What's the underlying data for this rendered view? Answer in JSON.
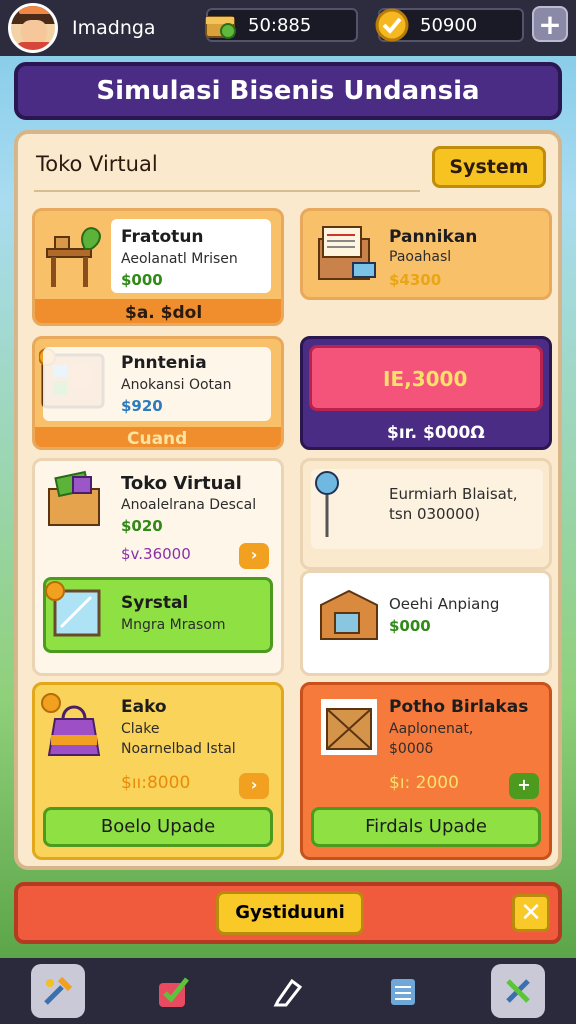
{
  "top": {
    "player_name": "Imadnga",
    "currency1": "50:885",
    "currency2": "50900"
  },
  "header": {
    "title": "Simulasi Bisenis Undansia"
  },
  "panel": {
    "title": "Toko Virtual",
    "system_button": "System"
  },
  "cards": [
    {
      "title": "Fratotun",
      "subtitle": "Aeolanatl Mrisen",
      "price": "$000",
      "footer": "$a. $dol"
    },
    {
      "title": "Pannikan",
      "subtitle": "Paoahasl",
      "price": "$4300"
    },
    {
      "title": "Pnntenia",
      "subtitle": "Anokansi Ootan",
      "price": "$920",
      "footer": "Cuand"
    },
    {
      "big_value": "IE,3000",
      "footer": "$ır. $000Ω"
    },
    {
      "title": "Toko Virtual",
      "subtitle": "Anoalelrana Descal",
      "price": "$020",
      "value": "$v.36000"
    },
    {
      "line1": "Eurmiarh Blaisat,",
      "line2": "tsn 030000)"
    },
    {
      "title": "Syrstal",
      "subtitle": "Mngra Mrasom"
    },
    {
      "title": "Oeehi Anpiang",
      "price": "$000"
    },
    {
      "title": "Eako",
      "subtitle": "Clake",
      "subtitle2": "Noarnelbad Istal",
      "value": "$ıı:8000",
      "button": "Boelo Upade"
    },
    {
      "title": "Potho Birlakas",
      "subtitle": "Aaplonenat,",
      "price": "$000δ",
      "value": "$ı: 2000",
      "button": "Firdals Upade"
    }
  ],
  "bottom": {
    "button": "Gystiduuni"
  },
  "icons": [
    "coin-chest-icon",
    "gold-check-coin-icon",
    "plus-icon",
    "tools-icon",
    "check-gift-icon",
    "pen-icon",
    "list-icon",
    "wrench-icon",
    "close-icon"
  ],
  "colors": {
    "accent_purple": "#4b2c84",
    "gold": "#f7c321",
    "green": "#8ee043",
    "orange_red": "#ef5b3c"
  }
}
